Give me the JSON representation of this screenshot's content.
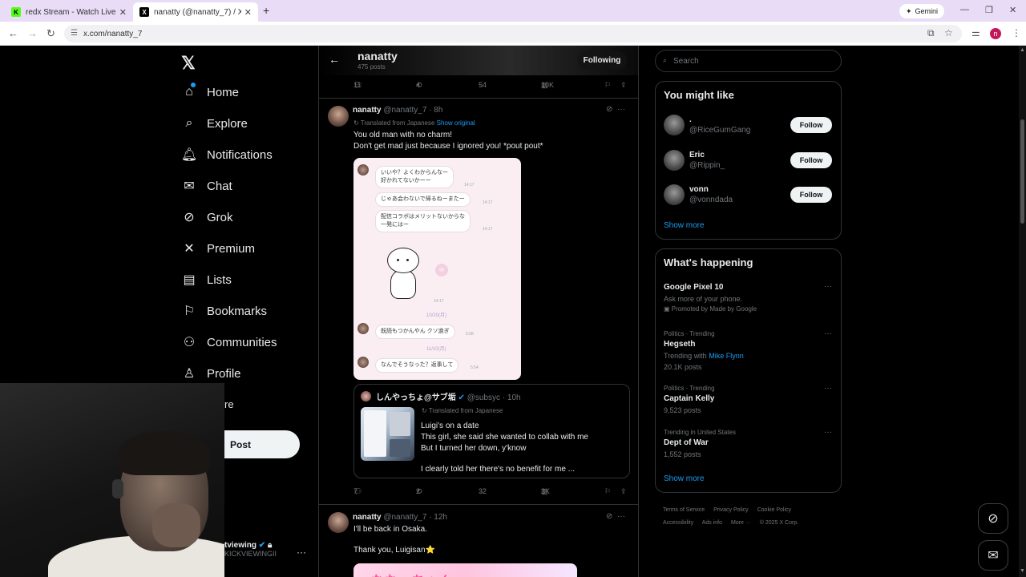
{
  "browser": {
    "tabs": [
      {
        "title": "redx Stream - Watch Live on Ki"
      },
      {
        "title": "nanatty (@nanatty_7) / X"
      }
    ],
    "gemini_label": "Gemini",
    "url": "x.com/nanatty_7"
  },
  "nav": {
    "items": [
      {
        "label": "Home",
        "icon": "home-icon"
      },
      {
        "label": "Explore",
        "icon": "search-icon"
      },
      {
        "label": "Notifications",
        "icon": "bell-icon"
      },
      {
        "label": "Chat",
        "icon": "mail-icon"
      },
      {
        "label": "Grok",
        "icon": "grok-icon"
      },
      {
        "label": "Premium",
        "icon": "x-icon"
      },
      {
        "label": "Lists",
        "icon": "list-icon"
      },
      {
        "label": "Bookmarks",
        "icon": "bookmark-icon"
      },
      {
        "label": "Communities",
        "icon": "people-icon"
      },
      {
        "label": "Profile",
        "icon": "person-icon"
      }
    ],
    "more_label": "re",
    "post_label": "Post",
    "account_name": "tviewing",
    "account_handle": "KICKVIEWINGII"
  },
  "profile_header": {
    "name": "nanatty",
    "posts_count": "475 posts",
    "following_label": "Following"
  },
  "top_actions": {
    "replies": "11",
    "reposts": "4",
    "likes": "54",
    "views": "10K"
  },
  "tweet1": {
    "name": "nanatty",
    "handle": "@nanatty_7",
    "time": "· 8h",
    "translated_label": "Translated from Japanese",
    "show_original": "Show original",
    "text_line1": "You old man with no charm!",
    "text_line2": "Don't get mad just because I ignored you! *pout pout*",
    "image": {
      "bubble1_line1": "いいや？よくわからんなー",
      "bubble1_line2": "好かれてないかーー",
      "bubble2": "じゃあ会わないで帰るねーまたー",
      "bubble3_line1": "配信コラボはメリットないからな",
      "bubble3_line2": "一発にはー",
      "date1": "10/20(月)",
      "bubble4": "既読もつかんやん クソ過ぎ",
      "date2": "11/10(月)",
      "bubble5": "なんでそうなった？返事して",
      "ts1": "14:17",
      "ts2": "14:17",
      "ts3": "14:17",
      "ts4": "14:17",
      "ts5": "5:08",
      "ts6": "5:54"
    },
    "quote": {
      "name": "しんやっちょ@サブ垢",
      "handle": "@subsyc",
      "time": "· 10h",
      "translated_label": "Translated from Japanese",
      "line1": "Luigi's on a date",
      "line2": "This girl, she said she wanted to collab with me",
      "line3": "But I turned her down, y'know",
      "line4": "I clearly told her there's no benefit for me  ..."
    },
    "actions": {
      "replies": "7",
      "reposts": "2",
      "likes": "32",
      "views": "3K"
    }
  },
  "tweet2": {
    "name": "nanatty",
    "handle": "@nanatty_7",
    "time": "· 12h",
    "line1": "I'll be back in Osaka.",
    "line2": "Thank you, Luigisan⭐",
    "image_text": "ななっちゃん"
  },
  "right": {
    "search_placeholder": "Search",
    "wtf_title": "You might like",
    "wtf": [
      {
        "name": ".",
        "handle": "@RiceGumGang",
        "follow": "Follow"
      },
      {
        "name": "Eric",
        "handle": "@Rippin_",
        "follow": "Follow"
      },
      {
        "name": "vonn",
        "handle": "@vonndada",
        "follow": "Follow"
      }
    ],
    "show_more": "Show more",
    "happening_title": "What's happening",
    "trends": [
      {
        "meta": "",
        "title": "Google Pixel 10",
        "sub": "Ask more of your phone.",
        "promoted": "Promoted by Made by Google"
      },
      {
        "meta": "Politics · Trending",
        "title": "Hegseth",
        "sub_prefix": "Trending with ",
        "sub_link": "Mike Flynn",
        "count": "20.1K posts"
      },
      {
        "meta": "Politics · Trending",
        "title": "Captain Kelly",
        "count": "9,523 posts"
      },
      {
        "meta": "Trending in United States",
        "title": "Dept of War",
        "count": "1,552 posts"
      }
    ],
    "show_more2": "Show more",
    "footer": {
      "terms": "Terms of Service",
      "privacy": "Privacy Policy",
      "cookie": "Cookie Policy",
      "accessibility": "Accessibility",
      "ads": "Ads info",
      "more": "More ···",
      "copyright": "© 2025 X Corp."
    }
  }
}
